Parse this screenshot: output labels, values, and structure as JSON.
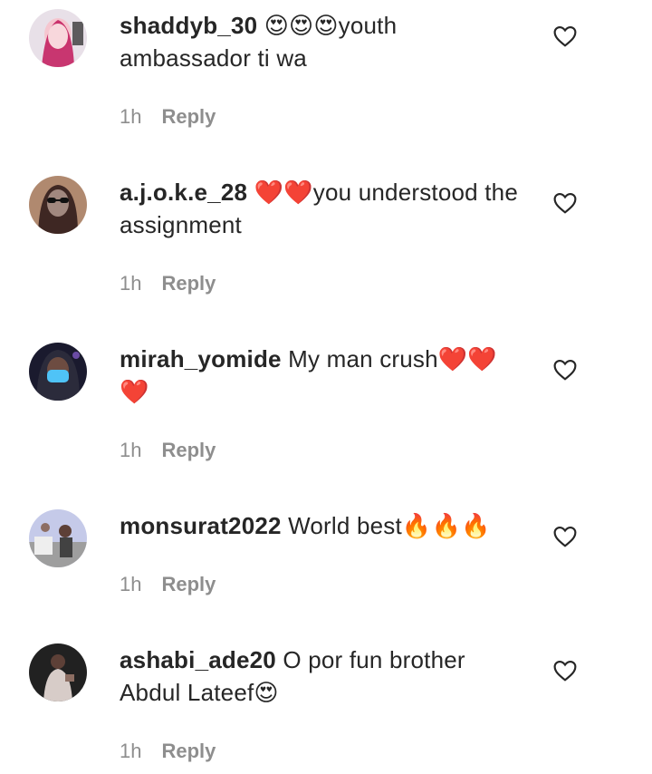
{
  "comments": [
    {
      "username": "shaddyb_30",
      "text_before": " ",
      "emoji": "😍😍😍",
      "text_after": "youth ambassador ti wa",
      "time": "1h",
      "reply_label": "Reply",
      "avatar_colors": [
        "#c2185b",
        "#f5c6cf"
      ]
    },
    {
      "username": "a.j.o.k.e_28",
      "text_before": " ",
      "emoji": "❤️❤️",
      "text_after": "you understood the assignment",
      "time": "1h",
      "reply_label": "Reply",
      "avatar_colors": [
        "#8d6e63",
        "#3e2723"
      ]
    },
    {
      "username": "mirah_yomide",
      "text_before": " My man crush",
      "emoji": "❤️❤️❤️",
      "text_after": "",
      "time": "1h",
      "reply_label": "Reply",
      "avatar_colors": [
        "#1a1a2e",
        "#4fc3f7"
      ]
    },
    {
      "username": "monsurat2022",
      "text_before": " World best",
      "emoji": "🔥🔥🔥",
      "text_after": "",
      "time": "1h",
      "reply_label": "Reply",
      "avatar_colors": [
        "#9e9e9e",
        "#c5cae9"
      ]
    },
    {
      "username": "ashabi_ade20",
      "text_before": " O por fun brother Abdul Lateef",
      "emoji": "😍",
      "text_after": "",
      "time": "1h",
      "reply_label": "Reply",
      "avatar_colors": [
        "#212121",
        "#d7ccc8"
      ]
    }
  ],
  "icons": {
    "like": "heart-outline-icon"
  }
}
